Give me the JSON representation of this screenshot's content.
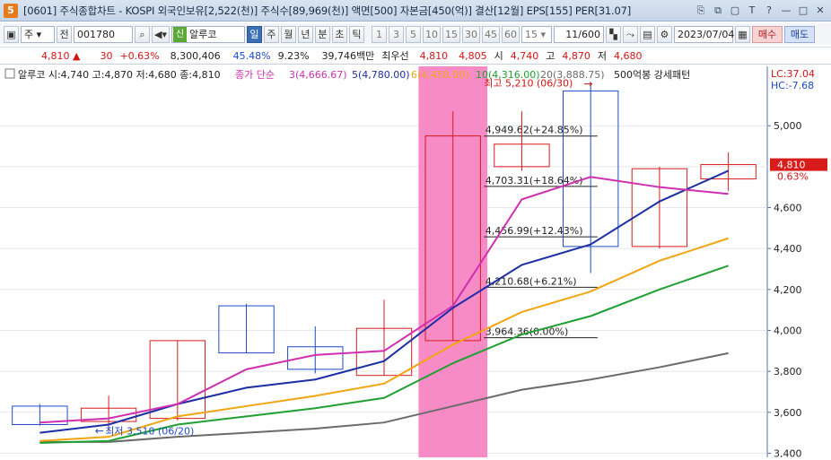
{
  "titlebar": {
    "app_badge": "5",
    "title": "[0601] 주식종합차트 - KOSPI 외국인보유[2,522(천)] 주식수[89,969(천)] 액면[500] 자본금[450(억)] 결산[12월] EPS[155] PER[31.07]",
    "buttons": [
      "copy-icon",
      "restore-icon",
      "window-icon",
      "font-T-icon",
      "help-icon",
      "minimize-icon",
      "maximize-icon",
      "close-icon"
    ],
    "button_glyphs": [
      "⎘",
      "⧉",
      "▢",
      "T",
      "?",
      "—",
      "□",
      "✕"
    ]
  },
  "toolbar": {
    "period_select": "주",
    "prev_label": "전",
    "code_value": "001780",
    "stock_badge": "신",
    "stock_name": "알루코",
    "timeframes": [
      "일",
      "주",
      "월",
      "년",
      "분",
      "초",
      "틱"
    ],
    "active_timeframe": "일",
    "intervals": [
      "1",
      "3",
      "5",
      "10",
      "15",
      "30",
      "45",
      "60"
    ],
    "interval_select": "15",
    "count_value": "11/600",
    "date_value": "2023/07/04",
    "buy_label": "매수",
    "sell_label": "매도"
  },
  "quote": {
    "price": "4,810",
    "arrow": "▲",
    "change": "30",
    "change_pct": "+0.63%",
    "volume": "8,300,406",
    "vol_ratio": "45.48%",
    "turnover": "9.23%",
    "amount": "39,746백만",
    "best_ask_label": "최우선",
    "best_ask": "4,810",
    "best_bid": "4,805",
    "open_label": "시",
    "open": "4,740",
    "high_label": "고",
    "high": "4,870",
    "low_label": "저",
    "low": "4,680"
  },
  "legend": {
    "main": "알루코 시:4,740 고:4,870 저:4,680 종:4,810",
    "ma_prefix": "종가 단순",
    "ma3": "3(4,666.67)",
    "ma5": "5(4,780.00)",
    "ma6": "6(4,450.00)",
    "ma10": "10(4,316.00)",
    "ma20": "20(3,888.75)",
    "pattern": "500억봉 강세패턴"
  },
  "chart_data": {
    "type": "candlestick",
    "candles": [
      {
        "o": 3630,
        "h": 3640,
        "l": 3535,
        "c": 3540,
        "up": false
      },
      {
        "o": 3555,
        "h": 3680,
        "l": 3510,
        "c": 3620,
        "up": true
      },
      {
        "o": 3570,
        "h": 3950,
        "l": 3560,
        "c": 3950,
        "up": true
      },
      {
        "o": 4120,
        "h": 4130,
        "l": 3890,
        "c": 3890,
        "up": false
      },
      {
        "o": 3920,
        "h": 4020,
        "l": 3790,
        "c": 3810,
        "up": false
      },
      {
        "o": 3780,
        "h": 4150,
        "l": 3780,
        "c": 4010,
        "up": true
      },
      {
        "o": 3950,
        "h": 5070,
        "l": 3950,
        "c": 4950,
        "up": true
      },
      {
        "o": 4800,
        "h": 5070,
        "l": 4780,
        "c": 4910,
        "up": true
      },
      {
        "o": 5170,
        "h": 5210,
        "l": 4280,
        "c": 4410,
        "up": false
      },
      {
        "o": 4410,
        "h": 4800,
        "l": 4400,
        "c": 4790,
        "up": true
      },
      {
        "o": 4740,
        "h": 4870,
        "l": 4680,
        "c": 4810,
        "up": true
      }
    ],
    "ma3": [
      3550,
      3570,
      3640,
      3810,
      3880,
      3900,
      4120,
      4640,
      4750,
      4700,
      4666.67
    ],
    "ma5": [
      3500,
      3540,
      3640,
      3720,
      3760,
      3850,
      4110,
      4320,
      4420,
      4630,
      4780
    ],
    "ma6": [
      3460,
      3480,
      3580,
      3630,
      3680,
      3740,
      3930,
      4090,
      4190,
      4340,
      4450
    ],
    "ma10": [
      3450,
      3460,
      3540,
      3580,
      3620,
      3670,
      3840,
      3980,
      4070,
      4200,
      4316
    ],
    "ma20": [
      3455,
      3455,
      3480,
      3500,
      3520,
      3550,
      3630,
      3710,
      3760,
      3820,
      3888.75
    ],
    "y_ticks": [
      3400,
      3600,
      3800,
      4000,
      4200,
      4400,
      4600,
      4800,
      5000
    ],
    "y_tick_labels": [
      "3,400",
      "3,600",
      "3,800",
      "4,000",
      "4,200",
      "4,400",
      "4,600",
      "4,810",
      "5,000"
    ],
    "ylim": [
      3380,
      5290
    ],
    "highlight_candle_index": 6,
    "fib_levels": [
      {
        "value": 4949.62,
        "label": "4,949.62(+24.85%)"
      },
      {
        "value": 4703.31,
        "label": "4,703.31(+18.64%)"
      },
      {
        "value": 4456.99,
        "label": "4,456.99(+12.43%)"
      },
      {
        "value": 4210.68,
        "label": "4,210.68(+6.21%)"
      },
      {
        "value": 3964.36,
        "label": "3,964.36(0.00%)"
      }
    ],
    "high_marker": {
      "value": 5210,
      "label": "최고 5,210 (06/30)"
    },
    "low_marker": {
      "value": 3510,
      "label": "최저 3,510 (06/20)"
    },
    "last_price_label": "4,810",
    "last_change_label": "0.63%",
    "lc_label": "LC:37.04",
    "hc_label": "HC:-7.68",
    "colors": {
      "up": "#d81b1b",
      "down": "#1d4bc7",
      "ma3": "#d02fb0",
      "ma5": "#1c2fa3",
      "ma6": "#f0a511",
      "ma10": "#20a032",
      "ma20": "#6b6b6b",
      "highlight": "#f78bc6"
    }
  }
}
